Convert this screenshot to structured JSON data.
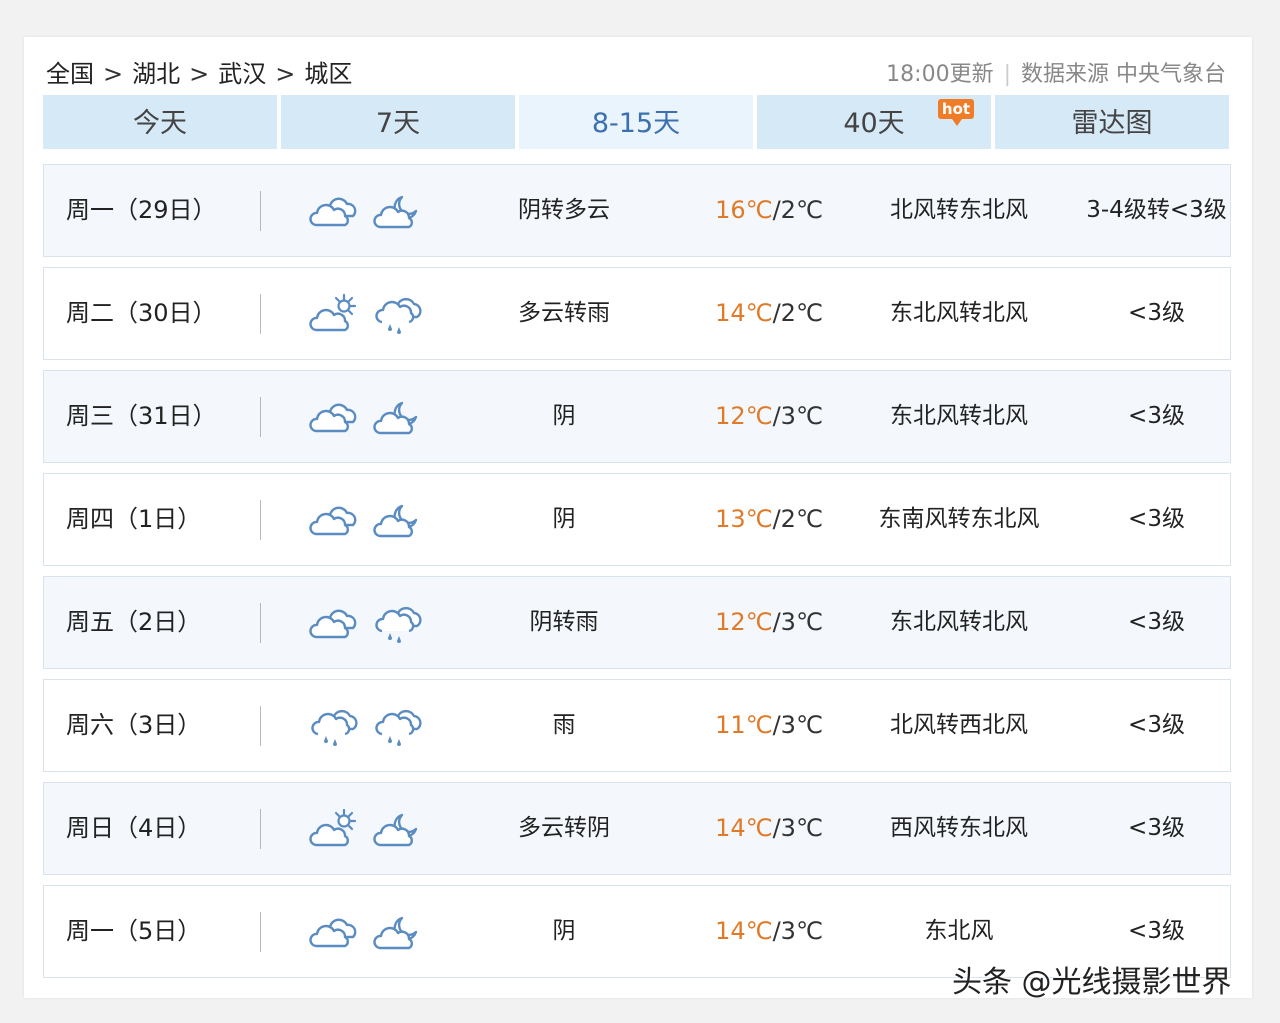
{
  "breadcrumb": {
    "items": [
      "全国",
      "湖北",
      "武汉",
      "城区"
    ],
    "separator": ">"
  },
  "meta": {
    "update_time": "18:00更新",
    "source": "数据来源 中央气象台"
  },
  "tabs": [
    {
      "label": "今天",
      "active": false
    },
    {
      "label": "7天",
      "active": false
    },
    {
      "label": "8-15天",
      "active": true
    },
    {
      "label": "40天",
      "active": false,
      "badge": "hot"
    },
    {
      "label": "雷达图",
      "active": false
    }
  ],
  "forecast": [
    {
      "date": "周一（29日）",
      "icons": [
        "cloudy-icon",
        "moon-cloud-icon"
      ],
      "desc": "阴转多云",
      "high": "16℃",
      "low": "2℃",
      "wind": "北风转东北风",
      "level": "3-4级转<3级"
    },
    {
      "date": "周二（30日）",
      "icons": [
        "sun-cloud-icon",
        "rain-icon"
      ],
      "desc": "多云转雨",
      "high": "14℃",
      "low": "2℃",
      "wind": "东北风转北风",
      "level": "<3级"
    },
    {
      "date": "周三（31日）",
      "icons": [
        "cloudy-icon",
        "moon-cloud-icon"
      ],
      "desc": "阴",
      "high": "12℃",
      "low": "3℃",
      "wind": "东北风转北风",
      "level": "<3级"
    },
    {
      "date": "周四（1日）",
      "icons": [
        "cloudy-icon",
        "moon-cloud-icon"
      ],
      "desc": "阴",
      "high": "13℃",
      "low": "2℃",
      "wind": "东南风转东北风",
      "level": "<3级"
    },
    {
      "date": "周五（2日）",
      "icons": [
        "cloudy-icon",
        "rain-icon"
      ],
      "desc": "阴转雨",
      "high": "12℃",
      "low": "3℃",
      "wind": "东北风转北风",
      "level": "<3级"
    },
    {
      "date": "周六（3日）",
      "icons": [
        "rain-icon",
        "rain-icon"
      ],
      "desc": "雨",
      "high": "11℃",
      "low": "3℃",
      "wind": "北风转西北风",
      "level": "<3级"
    },
    {
      "date": "周日（4日）",
      "icons": [
        "sun-cloud-icon",
        "moon-cloud-icon"
      ],
      "desc": "多云转阴",
      "high": "14℃",
      "low": "3℃",
      "wind": "西风转东北风",
      "level": "<3级"
    },
    {
      "date": "周一（5日）",
      "icons": [
        "cloudy-icon",
        "moon-cloud-icon"
      ],
      "desc": "阴",
      "high": "14℃",
      "low": "3℃",
      "wind": "东北风",
      "level": "<3级"
    }
  ],
  "temp_separator": "/",
  "watermark": "头条 @光线摄影世界",
  "colors": {
    "tab_bg": "#d6e9f7",
    "tab_active_bg": "#eaf4fc",
    "tab_active_text": "#3b6fb0",
    "high_temp": "#e07a28",
    "hot_badge": "#f07c28",
    "icon_stroke": "#5a8cc2"
  }
}
